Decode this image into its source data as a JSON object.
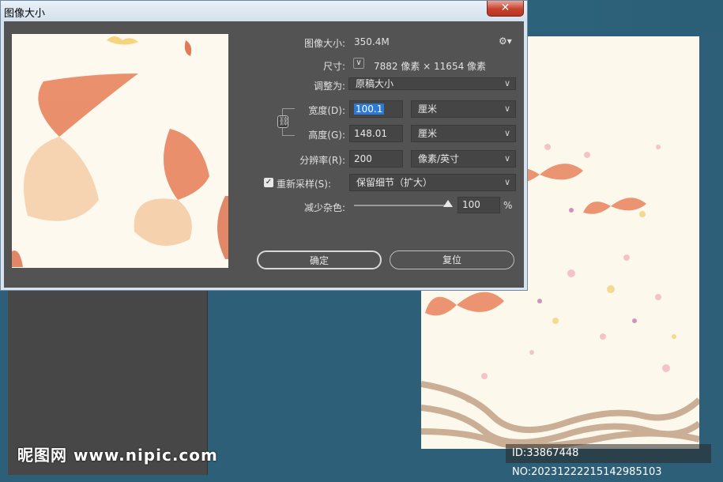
{
  "dialog": {
    "title": "图像大小",
    "close_label": "✕"
  },
  "settings": {
    "image_size_label": "图像大小:",
    "image_size_value": "350.4M",
    "gear_icon": "gear-icon"
  },
  "dimensions": {
    "label": "尺寸:",
    "value": "7882 像素 × 11654 像素"
  },
  "fit_to": {
    "label": "调整为:",
    "value": "原稿大小"
  },
  "width": {
    "label": "宽度(D):",
    "value": "100.1",
    "unit": "厘米"
  },
  "height": {
    "label": "高度(G):",
    "value": "148.01",
    "unit": "厘米"
  },
  "resolution": {
    "label": "分辨率(R):",
    "value": "200",
    "unit": "像素/英寸"
  },
  "resample": {
    "label": "重新采样(S):",
    "checked": true,
    "value": "保留细节（扩大）"
  },
  "noise": {
    "label": "减少杂色:",
    "value": "100",
    "unit": "%",
    "level": 1.0
  },
  "buttons": {
    "ok": "确定",
    "reset": "复位"
  },
  "watermarks": {
    "left": "昵图网 www.nipic.com",
    "right": "ID:33867448 NO:20231222215142985103"
  },
  "colors": {
    "dialog_body": "#535353",
    "highlight": "#2c7ad6",
    "close_button": "#c8412d"
  }
}
